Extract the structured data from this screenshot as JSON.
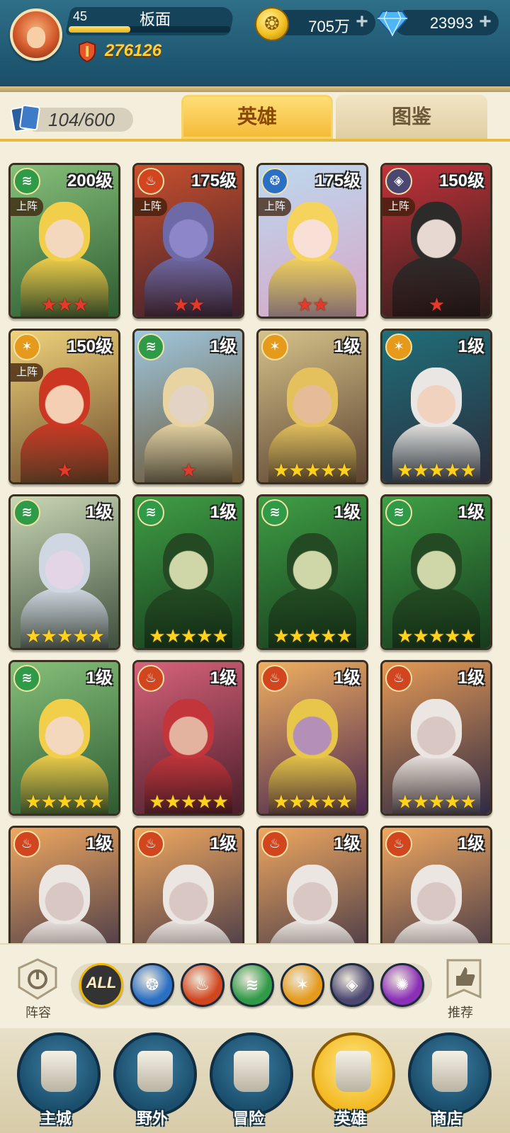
{
  "player": {
    "level": "45",
    "name": "板面",
    "xp_fraction": 0.38,
    "power": "276126"
  },
  "currency": {
    "gold": "705万",
    "diamonds": "23993",
    "plus_glyph": "+"
  },
  "heroes_panel": {
    "count": "104/600",
    "tabs": [
      {
        "label": "英雄",
        "active": true
      },
      {
        "label": "图鉴",
        "active": false
      }
    ]
  },
  "cards": [
    {
      "level": "200级",
      "element": "nature",
      "deployed": "上阵",
      "stars": "★★★",
      "star_color": "red",
      "bg": [
        "#86c07a",
        "#2d5b31"
      ],
      "hair": "#f2cf4a",
      "skin": "#f3d8bd"
    },
    {
      "level": "175级",
      "element": "fire",
      "deployed": "上阵",
      "stars": "★★",
      "star_color": "red",
      "bg": [
        "#c9502d",
        "#3a1e2c"
      ],
      "hair": "#6e6aa8",
      "skin": "#8d87c9"
    },
    {
      "level": "175级",
      "element": "water",
      "deployed": "上阵",
      "stars": "★★",
      "star_color": "red",
      "bg": [
        "#bcd9ee",
        "#d7a6c7"
      ],
      "hair": "#f5d35c",
      "skin": "#f8e0d6"
    },
    {
      "level": "150级",
      "element": "dark",
      "deployed": "上阵",
      "stars": "★",
      "star_color": "red",
      "bg": [
        "#c3333b",
        "#2a1d1a"
      ],
      "hair": "#2d2b2a",
      "skin": "#e7d8d2"
    },
    {
      "level": "150级",
      "element": "light",
      "deployed": "上阵",
      "stars": "★",
      "star_color": "red",
      "bg": [
        "#f0d37c",
        "#6b4a2a"
      ],
      "hair": "#cc3724",
      "skin": "#f5cfb3"
    },
    {
      "level": "1级",
      "element": "nature",
      "deployed": "",
      "stars": "★",
      "star_color": "red",
      "bg": [
        "#9fc8e0",
        "#6a5330"
      ],
      "hair": "#e8d4a2",
      "skin": "#e3d3c4"
    },
    {
      "level": "1级",
      "element": "light",
      "deployed": "",
      "stars": "★★★★★",
      "star_color": "gold",
      "bg": [
        "#d6c28a",
        "#5b4331"
      ],
      "hair": "#e5c15d",
      "skin": "#e6bb98"
    },
    {
      "level": "1级",
      "element": "light",
      "deployed": "",
      "stars": "★★★★★",
      "star_color": "gold",
      "bg": [
        "#1f6f7a",
        "#2b2b3a"
      ],
      "hair": "#e9e6e4",
      "skin": "#f0d2bf"
    },
    {
      "level": "1级",
      "element": "nature",
      "deployed": "",
      "stars": "★★★★★",
      "star_color": "gold",
      "bg": [
        "#c9d7b5",
        "#3e4f3c"
      ],
      "hair": "#cfd8e2",
      "skin": "#e3d5e6"
    },
    {
      "level": "1级",
      "element": "nature",
      "deployed": "",
      "stars": "★★★★★",
      "star_color": "gold",
      "bg": [
        "#3f9f45",
        "#163a1d"
      ],
      "hair": "#234a22",
      "skin": "#cfd6a8"
    },
    {
      "level": "1级",
      "element": "nature",
      "deployed": "",
      "stars": "★★★★★",
      "star_color": "gold",
      "bg": [
        "#3f9f45",
        "#163a1d"
      ],
      "hair": "#234a22",
      "skin": "#cfd6a8"
    },
    {
      "level": "1级",
      "element": "nature",
      "deployed": "",
      "stars": "★★★★★",
      "star_color": "gold",
      "bg": [
        "#3f9f45",
        "#163a1d"
      ],
      "hair": "#234a22",
      "skin": "#cfd6a8"
    },
    {
      "level": "1级",
      "element": "nature",
      "deployed": "",
      "stars": "★★★★★",
      "star_color": "gold",
      "bg": [
        "#86c07a",
        "#2d5b31"
      ],
      "hair": "#f2cf4a",
      "skin": "#f3d8bd"
    },
    {
      "level": "1级",
      "element": "fire",
      "deployed": "",
      "stars": "★★★★★",
      "star_color": "gold",
      "bg": [
        "#d7627a",
        "#4a1d2a"
      ],
      "hair": "#c2353b",
      "skin": "#e3b3a0"
    },
    {
      "level": "1级",
      "element": "fire",
      "deployed": "",
      "stars": "★★★★★",
      "star_color": "gold",
      "bg": [
        "#f0b060",
        "#4b2750"
      ],
      "hair": "#e8c64a",
      "skin": "#b48fb6"
    },
    {
      "level": "1级",
      "element": "fire",
      "deployed": "",
      "stars": "★★★★★",
      "star_color": "gold",
      "bg": [
        "#e49a55",
        "#2f2a44"
      ],
      "hair": "#ece6e2",
      "skin": "#d8c7c2"
    },
    {
      "level": "1级",
      "element": "fire",
      "deployed": "",
      "stars": "",
      "star_color": "gold",
      "bg": [
        "#f0a860",
        "#2f2a44"
      ],
      "hair": "#ece6e2",
      "skin": "#d8c7c2"
    },
    {
      "level": "1级",
      "element": "fire",
      "deployed": "",
      "stars": "",
      "star_color": "gold",
      "bg": [
        "#f0a860",
        "#2f2a44"
      ],
      "hair": "#ece6e2",
      "skin": "#d8c7c2"
    },
    {
      "level": "1级",
      "element": "fire",
      "deployed": "",
      "stars": "",
      "star_color": "gold",
      "bg": [
        "#f0a860",
        "#2f2a44"
      ],
      "hair": "#ece6e2",
      "skin": "#d8c7c2"
    },
    {
      "level": "1级",
      "element": "fire",
      "deployed": "",
      "stars": "",
      "star_color": "gold",
      "bg": [
        "#f0a860",
        "#2f2a44"
      ],
      "hair": "#ece6e2",
      "skin": "#d8c7c2"
    }
  ],
  "element_colors": {
    "nature": "#2f9a47",
    "fire": "#d2461f",
    "water": "#2a6fc4",
    "dark": "#4b4770",
    "light": "#e69a1c",
    "spirit": "#8a2fb7"
  },
  "filter_bar": {
    "lineup_label": "阵容",
    "recommend_label": "推荐",
    "chips": [
      {
        "id": "all",
        "label": "ALL",
        "selected": true
      },
      {
        "id": "water",
        "label": "",
        "icon": "water-element-icon"
      },
      {
        "id": "fire",
        "label": "",
        "icon": "fire-element-icon"
      },
      {
        "id": "nature",
        "label": "",
        "icon": "nature-element-icon"
      },
      {
        "id": "light",
        "label": "",
        "icon": "light-element-icon"
      },
      {
        "id": "dark",
        "label": "",
        "icon": "dark-element-icon"
      },
      {
        "id": "spirit",
        "label": "",
        "icon": "spirit-element-icon"
      }
    ]
  },
  "bottom_nav": [
    {
      "label": "主城",
      "icon": "castle-icon",
      "active": false
    },
    {
      "label": "野外",
      "icon": "portal-icon",
      "active": false
    },
    {
      "label": "冒险",
      "icon": "sword-icon",
      "active": false
    },
    {
      "label": "英雄",
      "icon": "knight-helmet-icon",
      "active": true
    },
    {
      "label": "商店",
      "icon": "shop-icon",
      "active": false
    }
  ]
}
